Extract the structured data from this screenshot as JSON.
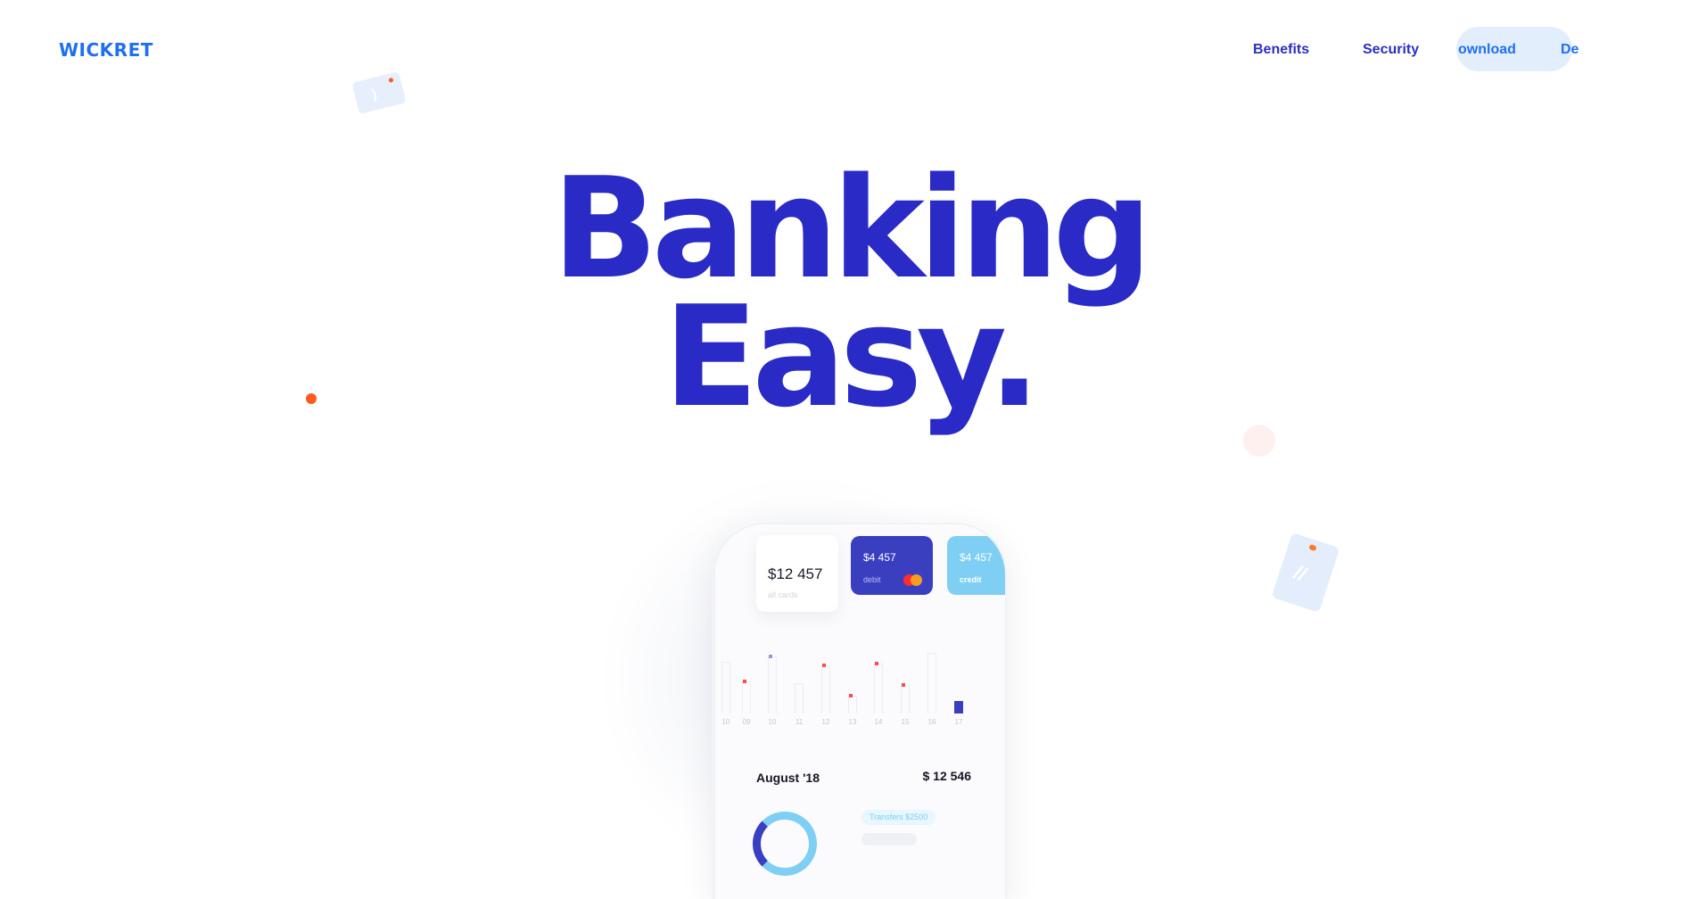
{
  "brand": {
    "name": "WICKRET"
  },
  "nav": {
    "items": [
      {
        "label": "Benefits"
      },
      {
        "label": "Security"
      },
      {
        "label": "ownload"
      },
      {
        "label": "De"
      }
    ]
  },
  "hero": {
    "line1": "Banking",
    "line2": "Easy."
  },
  "phone": {
    "cards": [
      {
        "amount": "$12 457",
        "caption": "all cards"
      },
      {
        "amount": "$4 457",
        "caption": "debit"
      },
      {
        "amount": "$4 457",
        "caption": "credit"
      }
    ],
    "chart_ticks": [
      "10",
      "09",
      "10",
      "11",
      "12",
      "13",
      "14",
      "15",
      "16",
      "17"
    ],
    "month_label": "August '18",
    "month_total": "$ 12 546",
    "transfers_tag": "Transfers  $2500"
  },
  "colors": {
    "brand_blue": "#2a2bc7",
    "logo_blue": "#1f6ff0",
    "accent_orange": "#ff5a1f",
    "pill_bg": "#e3eefc",
    "credit_card": "#7fcff4",
    "debit_card": "#3a3fc0"
  }
}
